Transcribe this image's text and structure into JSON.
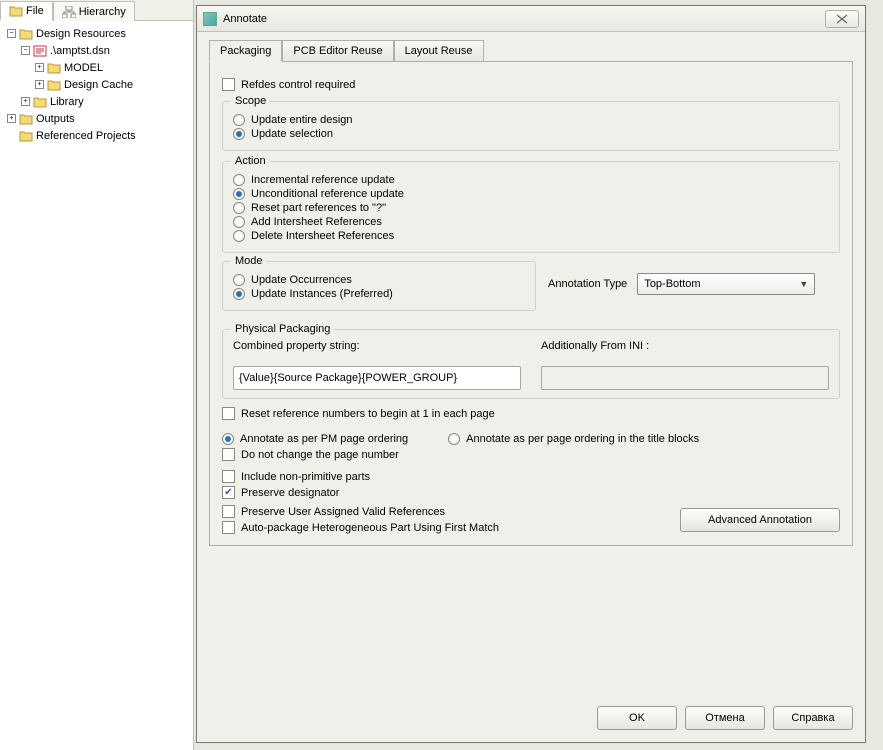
{
  "leftPanel": {
    "tabs": {
      "file": "File",
      "hierarchy": "Hierarchy"
    },
    "tree": {
      "root": "Design Resources",
      "dsn": ".\\amptst.dsn",
      "model": "MODEL",
      "cache": "Design Cache",
      "library": "Library",
      "outputs": "Outputs",
      "refprojects": "Referenced Projects"
    }
  },
  "dialog": {
    "title": "Annotate",
    "tabs": {
      "packaging": "Packaging",
      "pcbreuse": "PCB Editor Reuse",
      "layoutreuse": "Layout Reuse"
    },
    "refdesControl": "Refdes control required",
    "scope": {
      "title": "Scope",
      "entire": "Update entire design",
      "selection": "Update selection"
    },
    "action": {
      "title": "Action",
      "incr": "Incremental reference update",
      "uncond": "Unconditional reference update",
      "reset": "Reset part references to \"?\"",
      "addIs": "Add Intersheet References",
      "delIs": "Delete Intersheet References"
    },
    "mode": {
      "title": "Mode",
      "occ": "Update Occurrences",
      "inst": "Update Instances (Preferred)"
    },
    "annType": {
      "label": "Annotation Type",
      "value": "Top-Bottom"
    },
    "phys": {
      "title": "Physical Packaging",
      "combinedLabel": "Combined property string:",
      "combinedValue": "{Value}{Source Package}{POWER_GROUP}",
      "iniLabel": "Additionally From INI :",
      "iniValue": ""
    },
    "bottom": {
      "resetBegin1": "Reset reference numbers to begin at 1 in each page",
      "pmOrdering": "Annotate as per PM page ordering",
      "titleBlocks": "Annotate as per page ordering in the title blocks",
      "noChangePage": "Do not change the page number",
      "includeNonPrim": "Include non-primitive parts",
      "preserveDesig": "Preserve designator",
      "preserveUser": "Preserve User Assigned Valid References",
      "autoPkg": "Auto-package Heterogeneous Part Using First Match",
      "advanced": "Advanced Annotation"
    },
    "footer": {
      "ok": "OK",
      "cancel": "Отмена",
      "help": "Справка"
    }
  }
}
